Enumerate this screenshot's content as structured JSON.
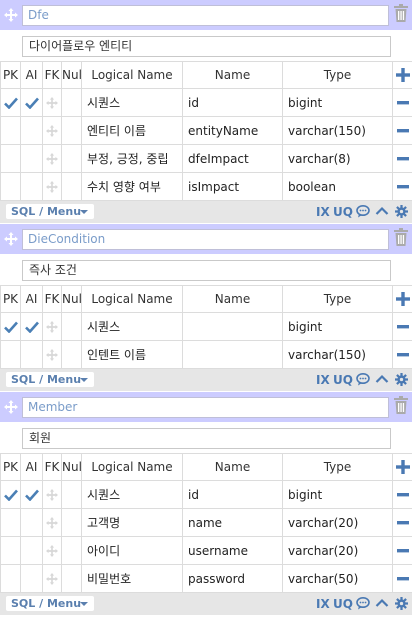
{
  "columns_header": {
    "pk": "PK",
    "ai": "AI",
    "fk": "FK",
    "null": "Null",
    "logical_name": "Logical Name",
    "name": "Name",
    "type": "Type"
  },
  "footer": {
    "sql_menu": "SQL / Menu",
    "ix": "IX",
    "uq": "UQ"
  },
  "colors": {
    "header_bg": "#ccccff",
    "icon_blue": "#4a79b3",
    "check_blue": "#4a7fb5",
    "trash_gray": "#aaaaaa",
    "footer_bg": "#e6e6e6"
  },
  "entities": [
    {
      "name": "Dfe",
      "logical_name": "다이어플로우 엔티티",
      "rows": [
        {
          "pk": true,
          "ai": true,
          "logical": "시퀀스",
          "name": "id",
          "type": "bigint"
        },
        {
          "pk": false,
          "ai": false,
          "logical": "엔티티 이름",
          "name": "entityName",
          "type": "varchar(150)"
        },
        {
          "pk": false,
          "ai": false,
          "logical": "부정, 긍정, 중립",
          "name": "dfeImpact",
          "type": "varchar(8)"
        },
        {
          "pk": false,
          "ai": false,
          "logical": "수치 영향 여부",
          "name": "isImpact",
          "type": "boolean"
        }
      ]
    },
    {
      "name": "DieCondition",
      "logical_name": "즉사 조건",
      "rows": [
        {
          "pk": true,
          "ai": true,
          "logical": "시퀀스",
          "name": "",
          "type": "bigint"
        },
        {
          "pk": false,
          "ai": false,
          "logical": "인텐트 이름",
          "name": "",
          "type": "varchar(150)"
        }
      ]
    },
    {
      "name": "Member",
      "logical_name": "회원",
      "rows": [
        {
          "pk": true,
          "ai": true,
          "logical": "시퀀스",
          "name": "id",
          "type": "bigint"
        },
        {
          "pk": false,
          "ai": false,
          "logical": "고객명",
          "name": "name",
          "type": "varchar(20)"
        },
        {
          "pk": false,
          "ai": false,
          "logical": "아이디",
          "name": "username",
          "type": "varchar(20)"
        },
        {
          "pk": false,
          "ai": false,
          "logical": "비밀번호",
          "name": "password",
          "type": "varchar(50)"
        }
      ]
    }
  ]
}
